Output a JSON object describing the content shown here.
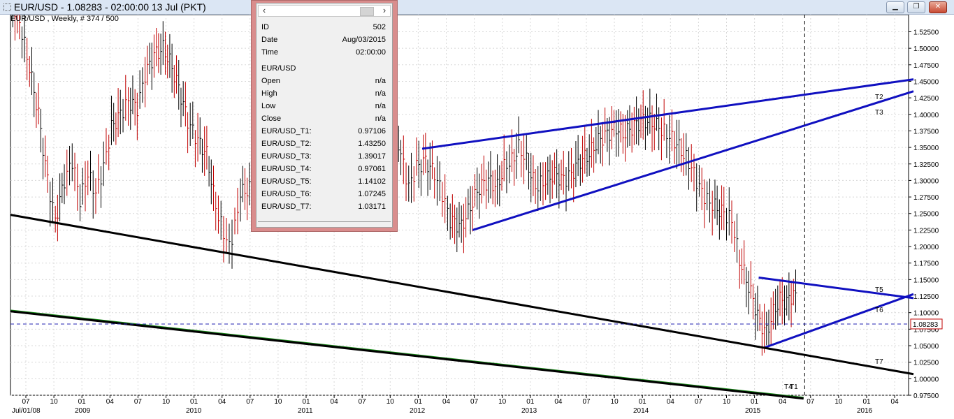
{
  "window": {
    "title": "EUR/USD - 1.08283 - 02:00:00  13 Jul (PKT)",
    "symbol_info": "EUR/USD , Weekly, # 374 / 500",
    "minimize": "▁",
    "restore": "❐",
    "close": "✕"
  },
  "data_window": {
    "scroll_left": "‹",
    "scroll_right": "›",
    "rows": [
      {
        "key": "ID",
        "value": "502"
      },
      {
        "key": "Date",
        "value": "Aug/03/2015"
      },
      {
        "key": "Time",
        "value": "02:00:00"
      },
      {
        "key": "EUR/USD",
        "value": ""
      },
      {
        "key": "Open",
        "value": "n/a"
      },
      {
        "key": "High",
        "value": "n/a"
      },
      {
        "key": "Low",
        "value": "n/a"
      },
      {
        "key": "Close",
        "value": "n/a"
      },
      {
        "key": "EUR/USD_T1:",
        "value": "0.97106"
      },
      {
        "key": "EUR/USD_T2:",
        "value": "1.43250"
      },
      {
        "key": "EUR/USD_T3:",
        "value": "1.39017"
      },
      {
        "key": "EUR/USD_T4:",
        "value": "0.97061"
      },
      {
        "key": "EUR/USD_T5:",
        "value": "1.14102"
      },
      {
        "key": "EUR/USD_T6:",
        "value": "1.07245"
      },
      {
        "key": "EUR/USD_T7:",
        "value": "1.03171"
      }
    ]
  },
  "chart_data": {
    "type": "candlestick",
    "symbol": "EUR/USD",
    "timeframe": "Weekly",
    "last_price": "1.08283",
    "ylim": [
      0.975,
      1.535
    ],
    "y_ticks": [
      "1.52500",
      "1.50000",
      "1.47500",
      "1.45000",
      "1.42500",
      "1.40000",
      "1.37500",
      "1.35000",
      "1.32500",
      "1.30000",
      "1.27500",
      "1.25000",
      "1.22500",
      "1.20000",
      "1.17500",
      "1.15000",
      "1.12500",
      "1.10000",
      "1.07500",
      "1.05000",
      "1.02500",
      "1.00000",
      "0.97500"
    ],
    "x_ticks": [
      "07",
      "10",
      "01",
      "04",
      "07",
      "10",
      "01",
      "04",
      "07",
      "10",
      "01",
      "04",
      "07",
      "10",
      "01",
      "04",
      "07",
      "10",
      "01",
      "04",
      "07",
      "10",
      "01",
      "04",
      "07",
      "10",
      "01",
      "04",
      "07",
      "10",
      "01",
      "04"
    ],
    "x_year_labels": [
      "Jul/01/08",
      "2009",
      "2010",
      "2011",
      "2012",
      "2013",
      "2014",
      "2015",
      "2016"
    ],
    "price_path": [
      [
        2008.5,
        1.57
      ],
      [
        2008.58,
        1.54
      ],
      [
        2008.67,
        1.47
      ],
      [
        2008.75,
        1.4
      ],
      [
        2008.83,
        1.3
      ],
      [
        2008.9,
        1.24
      ],
      [
        2008.98,
        1.3
      ],
      [
        2009.05,
        1.33
      ],
      [
        2009.12,
        1.27
      ],
      [
        2009.19,
        1.31
      ],
      [
        2009.26,
        1.28
      ],
      [
        2009.33,
        1.32
      ],
      [
        2009.4,
        1.38
      ],
      [
        2009.48,
        1.4
      ],
      [
        2009.55,
        1.42
      ],
      [
        2009.63,
        1.41
      ],
      [
        2009.7,
        1.46
      ],
      [
        2009.78,
        1.49
      ],
      [
        2009.86,
        1.5
      ],
      [
        2009.92,
        1.48
      ],
      [
        2010.0,
        1.44
      ],
      [
        2010.08,
        1.39
      ],
      [
        2010.17,
        1.36
      ],
      [
        2010.25,
        1.34
      ],
      [
        2010.33,
        1.26
      ],
      [
        2010.4,
        1.22
      ],
      [
        2010.45,
        1.2
      ],
      [
        2010.5,
        1.23
      ],
      [
        2010.55,
        1.28
      ],
      [
        2010.65,
        1.29
      ]
    ],
    "price_path_2": [
      [
        2011.9,
        1.41
      ],
      [
        2011.98,
        1.34
      ],
      [
        2012.05,
        1.29
      ],
      [
        2012.12,
        1.32
      ],
      [
        2012.2,
        1.33
      ],
      [
        2012.28,
        1.31
      ],
      [
        2012.35,
        1.28
      ],
      [
        2012.42,
        1.24
      ],
      [
        2012.52,
        1.23
      ],
      [
        2012.6,
        1.26
      ],
      [
        2012.68,
        1.29
      ],
      [
        2012.76,
        1.3
      ],
      [
        2012.84,
        1.29
      ],
      [
        2012.9,
        1.32
      ],
      [
        2012.97,
        1.33
      ],
      [
        2013.03,
        1.35
      ],
      [
        2013.1,
        1.33
      ],
      [
        2013.18,
        1.29
      ],
      [
        2013.27,
        1.3
      ],
      [
        2013.35,
        1.31
      ],
      [
        2013.43,
        1.3
      ],
      [
        2013.5,
        1.31
      ],
      [
        2013.58,
        1.33
      ],
      [
        2013.66,
        1.34
      ],
      [
        2013.74,
        1.36
      ],
      [
        2013.82,
        1.37
      ],
      [
        2013.9,
        1.38
      ],
      [
        2013.96,
        1.37
      ],
      [
        2014.04,
        1.38
      ],
      [
        2014.12,
        1.39
      ],
      [
        2014.2,
        1.39
      ],
      [
        2014.28,
        1.38
      ],
      [
        2014.35,
        1.37
      ],
      [
        2014.42,
        1.36
      ],
      [
        2014.5,
        1.34
      ],
      [
        2014.57,
        1.32
      ],
      [
        2014.64,
        1.29
      ],
      [
        2014.71,
        1.27
      ],
      [
        2014.78,
        1.26
      ],
      [
        2014.86,
        1.25
      ],
      [
        2014.93,
        1.24
      ],
      [
        2015.0,
        1.18
      ],
      [
        2015.06,
        1.15
      ],
      [
        2015.12,
        1.12
      ],
      [
        2015.18,
        1.085
      ],
      [
        2015.24,
        1.07
      ],
      [
        2015.3,
        1.1
      ],
      [
        2015.36,
        1.12
      ],
      [
        2015.42,
        1.115
      ],
      [
        2015.48,
        1.13
      ],
      [
        2015.52,
        1.11
      ]
    ],
    "trendlines": [
      {
        "name": "T1",
        "color": "#1a8a1a",
        "from": [
          2008.5,
          1.103
        ],
        "to": [
          2015.57,
          0.971
        ]
      },
      {
        "name": "T2",
        "color": "#1010c0",
        "from": [
          2012.17,
          1.348
        ],
        "to": [
          2016.55,
          1.453
        ]
      },
      {
        "name": "T3",
        "color": "#1010c0",
        "from": [
          2012.62,
          1.225
        ],
        "to": [
          2016.55,
          1.435
        ]
      },
      {
        "name": "T4",
        "color": "#000000",
        "from": [
          2008.5,
          1.102
        ],
        "to": [
          2015.57,
          0.97
        ]
      },
      {
        "name": "T5",
        "color": "#1010c0",
        "from": [
          2015.17,
          1.153
        ],
        "to": [
          2016.55,
          1.122
        ]
      },
      {
        "name": "T6",
        "color": "#1010c0",
        "from": [
          2015.22,
          1.047
        ],
        "to": [
          2016.55,
          1.128
        ]
      },
      {
        "name": "T7",
        "color": "#000000",
        "from": [
          2008.5,
          1.248
        ],
        "to": [
          2016.55,
          1.007
        ]
      }
    ],
    "vertical_marker": "2015.58",
    "text_labels": [
      "T2",
      "T3",
      "T5",
      "T6",
      "T7",
      "T4",
      "T1"
    ]
  }
}
